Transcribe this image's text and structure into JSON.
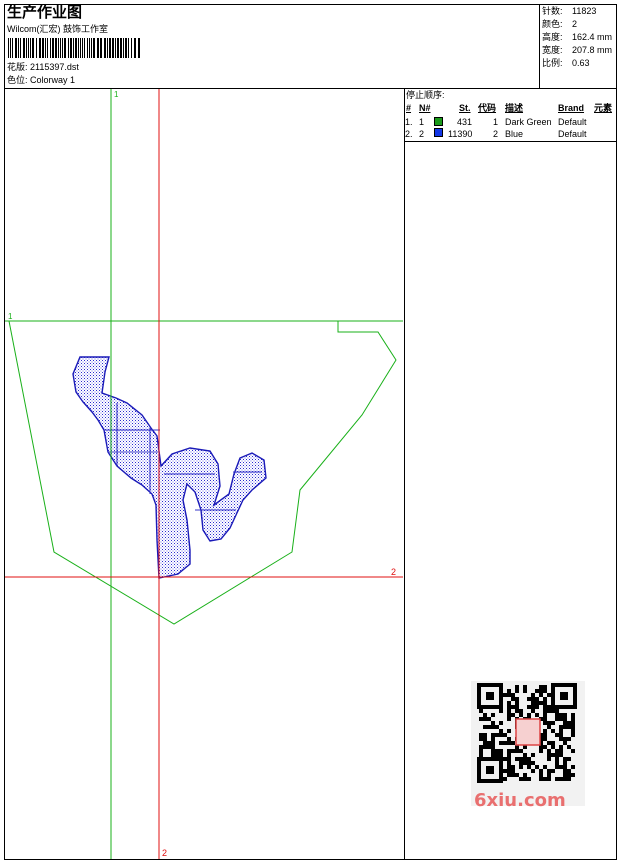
{
  "header": {
    "title": "生产作业图",
    "studio": "Wilcom(汇宏) 鼓饰工作室",
    "design_label": "花版: 2115397.dst",
    "colorway_label": "色位:  Colorway 1"
  },
  "stats": [
    {
      "label": "针数:",
      "value": "11823"
    },
    {
      "label": "颜色:",
      "value": "2"
    },
    {
      "label": "高度:",
      "value": "162.4 mm"
    },
    {
      "label": "宽度:",
      "value": "207.8 mm"
    },
    {
      "label": "比例:",
      "value": "0.63"
    }
  ],
  "stop_sequence": {
    "title": "停止顺序:",
    "columns": [
      "#",
      "N#",
      "St.",
      "代码",
      "描述",
      "Brand",
      "元素"
    ],
    "rows": [
      {
        "index": "1.",
        "n": "1",
        "color": "#1a9a1a",
        "stitches": "431",
        "code": "1",
        "desc": "Dark Green",
        "brand": "Default"
      },
      {
        "index": "2.",
        "n": "2",
        "color": "#1236e6",
        "stitches": "11390",
        "code": "2",
        "desc": "Blue",
        "brand": "Default"
      }
    ]
  },
  "axes": {
    "green_v_label": "1",
    "green_h_label": "1",
    "red_h_label": "2",
    "red_v_label": "2",
    "green_color": "#19b019",
    "red_color": "#e01010"
  },
  "watermark": {
    "text": "6xiu.com",
    "color": "#e96f6f"
  }
}
